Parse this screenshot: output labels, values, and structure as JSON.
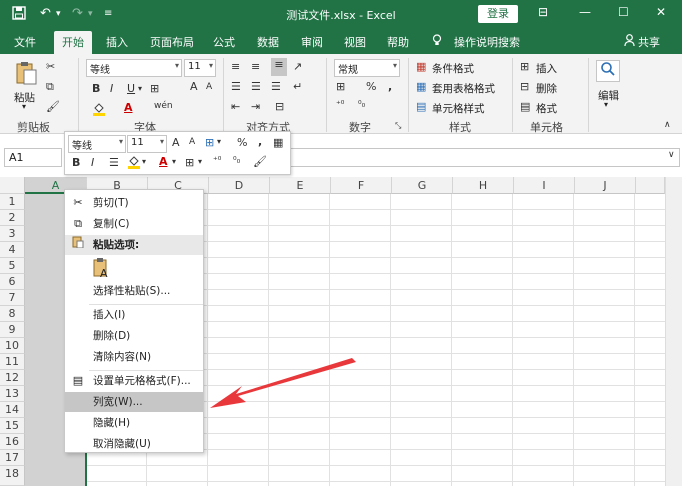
{
  "title": {
    "text": "测试文件.xlsx  -  Excel",
    "login": "登录",
    "save_icon": "save-icon",
    "undo_icon": "undo-icon",
    "redo_icon": "redo-icon",
    "customize_icon": "customize-icon",
    "minimize": "—",
    "maximize": "☐",
    "close": "✕",
    "ribbon_toggle": "⊟"
  },
  "tabs": {
    "file": "文件",
    "home": "开始",
    "insert": "插入",
    "layout": "页面布局",
    "formulas": "公式",
    "data": "数据",
    "review": "审阅",
    "view": "视图",
    "help": "帮助",
    "tell": "操作说明搜索",
    "share": "共享"
  },
  "ribbon": {
    "paste": "粘贴",
    "clipboard": "剪贴板",
    "font_name": "等线",
    "font_size": "11",
    "font": "字体",
    "alignment": "对齐方式",
    "number_format": "常规",
    "number": "数字",
    "cond_format": "条件格式",
    "table_format": "套用表格格式",
    "cell_style": "单元格样式",
    "styles": "样式",
    "insert": "插入",
    "delete": "删除",
    "format": "格式",
    "cells": "单元格",
    "edit": "编辑",
    "bold": "B",
    "italic": "I",
    "underline": "U",
    "percent": "%",
    "comma": ",",
    "font_color_letter": "A",
    "wen": "wén",
    "grow": "A",
    "shrink": "A"
  },
  "formula": {
    "name_box": "A1",
    "value": ""
  },
  "columns": [
    "A",
    "B",
    "C",
    "D",
    "E",
    "F",
    "G",
    "H",
    "I",
    "J"
  ],
  "rows": [
    "1",
    "2",
    "3",
    "4",
    "5",
    "6",
    "7",
    "8",
    "9",
    "10",
    "11",
    "12",
    "13",
    "14",
    "15",
    "16",
    "17",
    "18"
  ],
  "mini_toolbar": {
    "font_name": "等线",
    "font_size": "11",
    "percent": "%",
    "comma": ",",
    "bold": "B",
    "italic": "I",
    "grow": "A",
    "shrink": "A",
    "font_color_letter": "A"
  },
  "context_menu": {
    "cut": "剪切(T)",
    "copy": "复制(C)",
    "paste_options": "粘贴选项:",
    "paste_special": "选择性粘贴(S)...",
    "insert": "插入(I)",
    "delete": "删除(D)",
    "clear": "清除内容(N)",
    "format_cells": "设置单元格格式(F)...",
    "column_width": "列宽(W)...",
    "hide": "隐藏(H)",
    "unhide": "取消隐藏(U)"
  },
  "colors": {
    "brand": "#217346",
    "arrow": "#e8383b",
    "highlight": "#c6c6c6"
  }
}
